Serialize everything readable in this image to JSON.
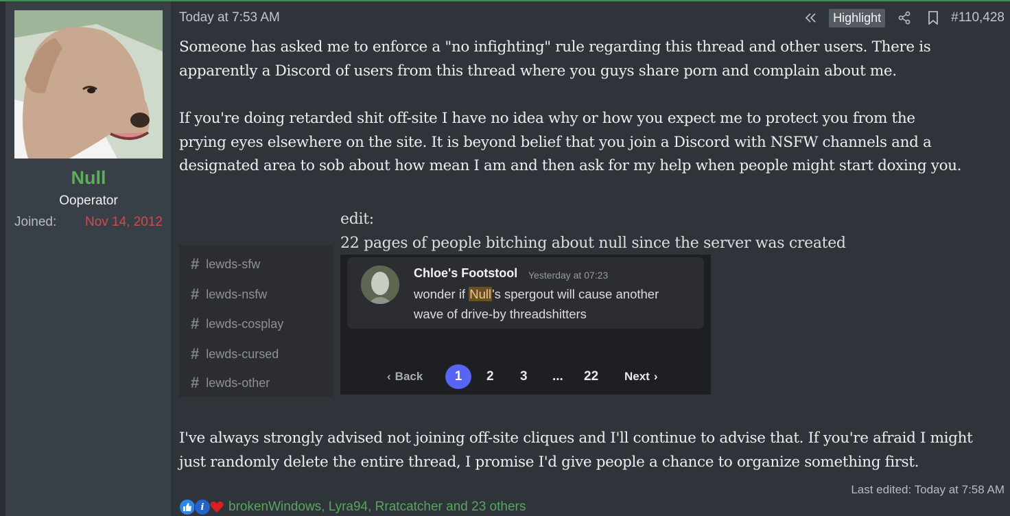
{
  "user": {
    "name": "Null",
    "title": "Ooperator",
    "joined_label": "Joined:",
    "joined_value": "Nov 14, 2012",
    "avatar_icon": "dog-avatar-icon"
  },
  "post": {
    "date": "Today at 7:53 AM",
    "highlight_label": "Highlight",
    "post_number": "#110,428",
    "paragraph1": [
      "Someone has asked me to enforce a \"no infighting\" rule regarding this thread and other users. There is",
      "apparently a Discord of users from this thread where you guys share porn and complain about me."
    ],
    "paragraph2": [
      "If you're doing retarded shit off-site I have no idea why or how you expect me to protect you from the",
      "prying eyes elsewhere on the site. It is beyond belief that you join a Discord with NSFW channels and a",
      "designated area to sob about how mean I am and then ask for my help when people might start doxing you."
    ],
    "paragraph3": [
      "I've always strongly advised not joining off-site cliques and I'll continue to advise that. If you're afraid I might",
      "just randomly delete the entire thread, I promise I'd give people a chance to organize something first."
    ],
    "last_edited": "Last edited: Today at 7:58 AM"
  },
  "embed": {
    "edit_line1": "edit:",
    "edit_line2": "22 pages of people bitching about null since the server was created",
    "channels": [
      "lewds-sfw",
      "lewds-nsfw",
      "lewds-cosplay",
      "lewds-cursed",
      "lewds-other"
    ],
    "message": {
      "author": "Chloe's Footstool",
      "time": "Yesterday at 07:23",
      "line1_pre": "wonder if ",
      "line1_mention": "Null",
      "line1_post": "'s spergout will cause another",
      "line2": "wave of drive-by threadshitters"
    },
    "pager": {
      "back": "Back",
      "pages": [
        "1",
        "2",
        "3",
        "...",
        "22"
      ],
      "next": "Next"
    }
  },
  "reactions": {
    "names": "brokenWindows, Lyra94, Rratcatcher and 23 others",
    "icons": [
      "like-icon",
      "informative-icon",
      "heart-icon"
    ]
  },
  "colors": {
    "background": "#2f343b",
    "sidebar": "#393f47",
    "username": "#5cae5c",
    "joined_date": "#d24a4a",
    "reaction_names": "#55a85a",
    "discord_accent": "#5865f2"
  }
}
